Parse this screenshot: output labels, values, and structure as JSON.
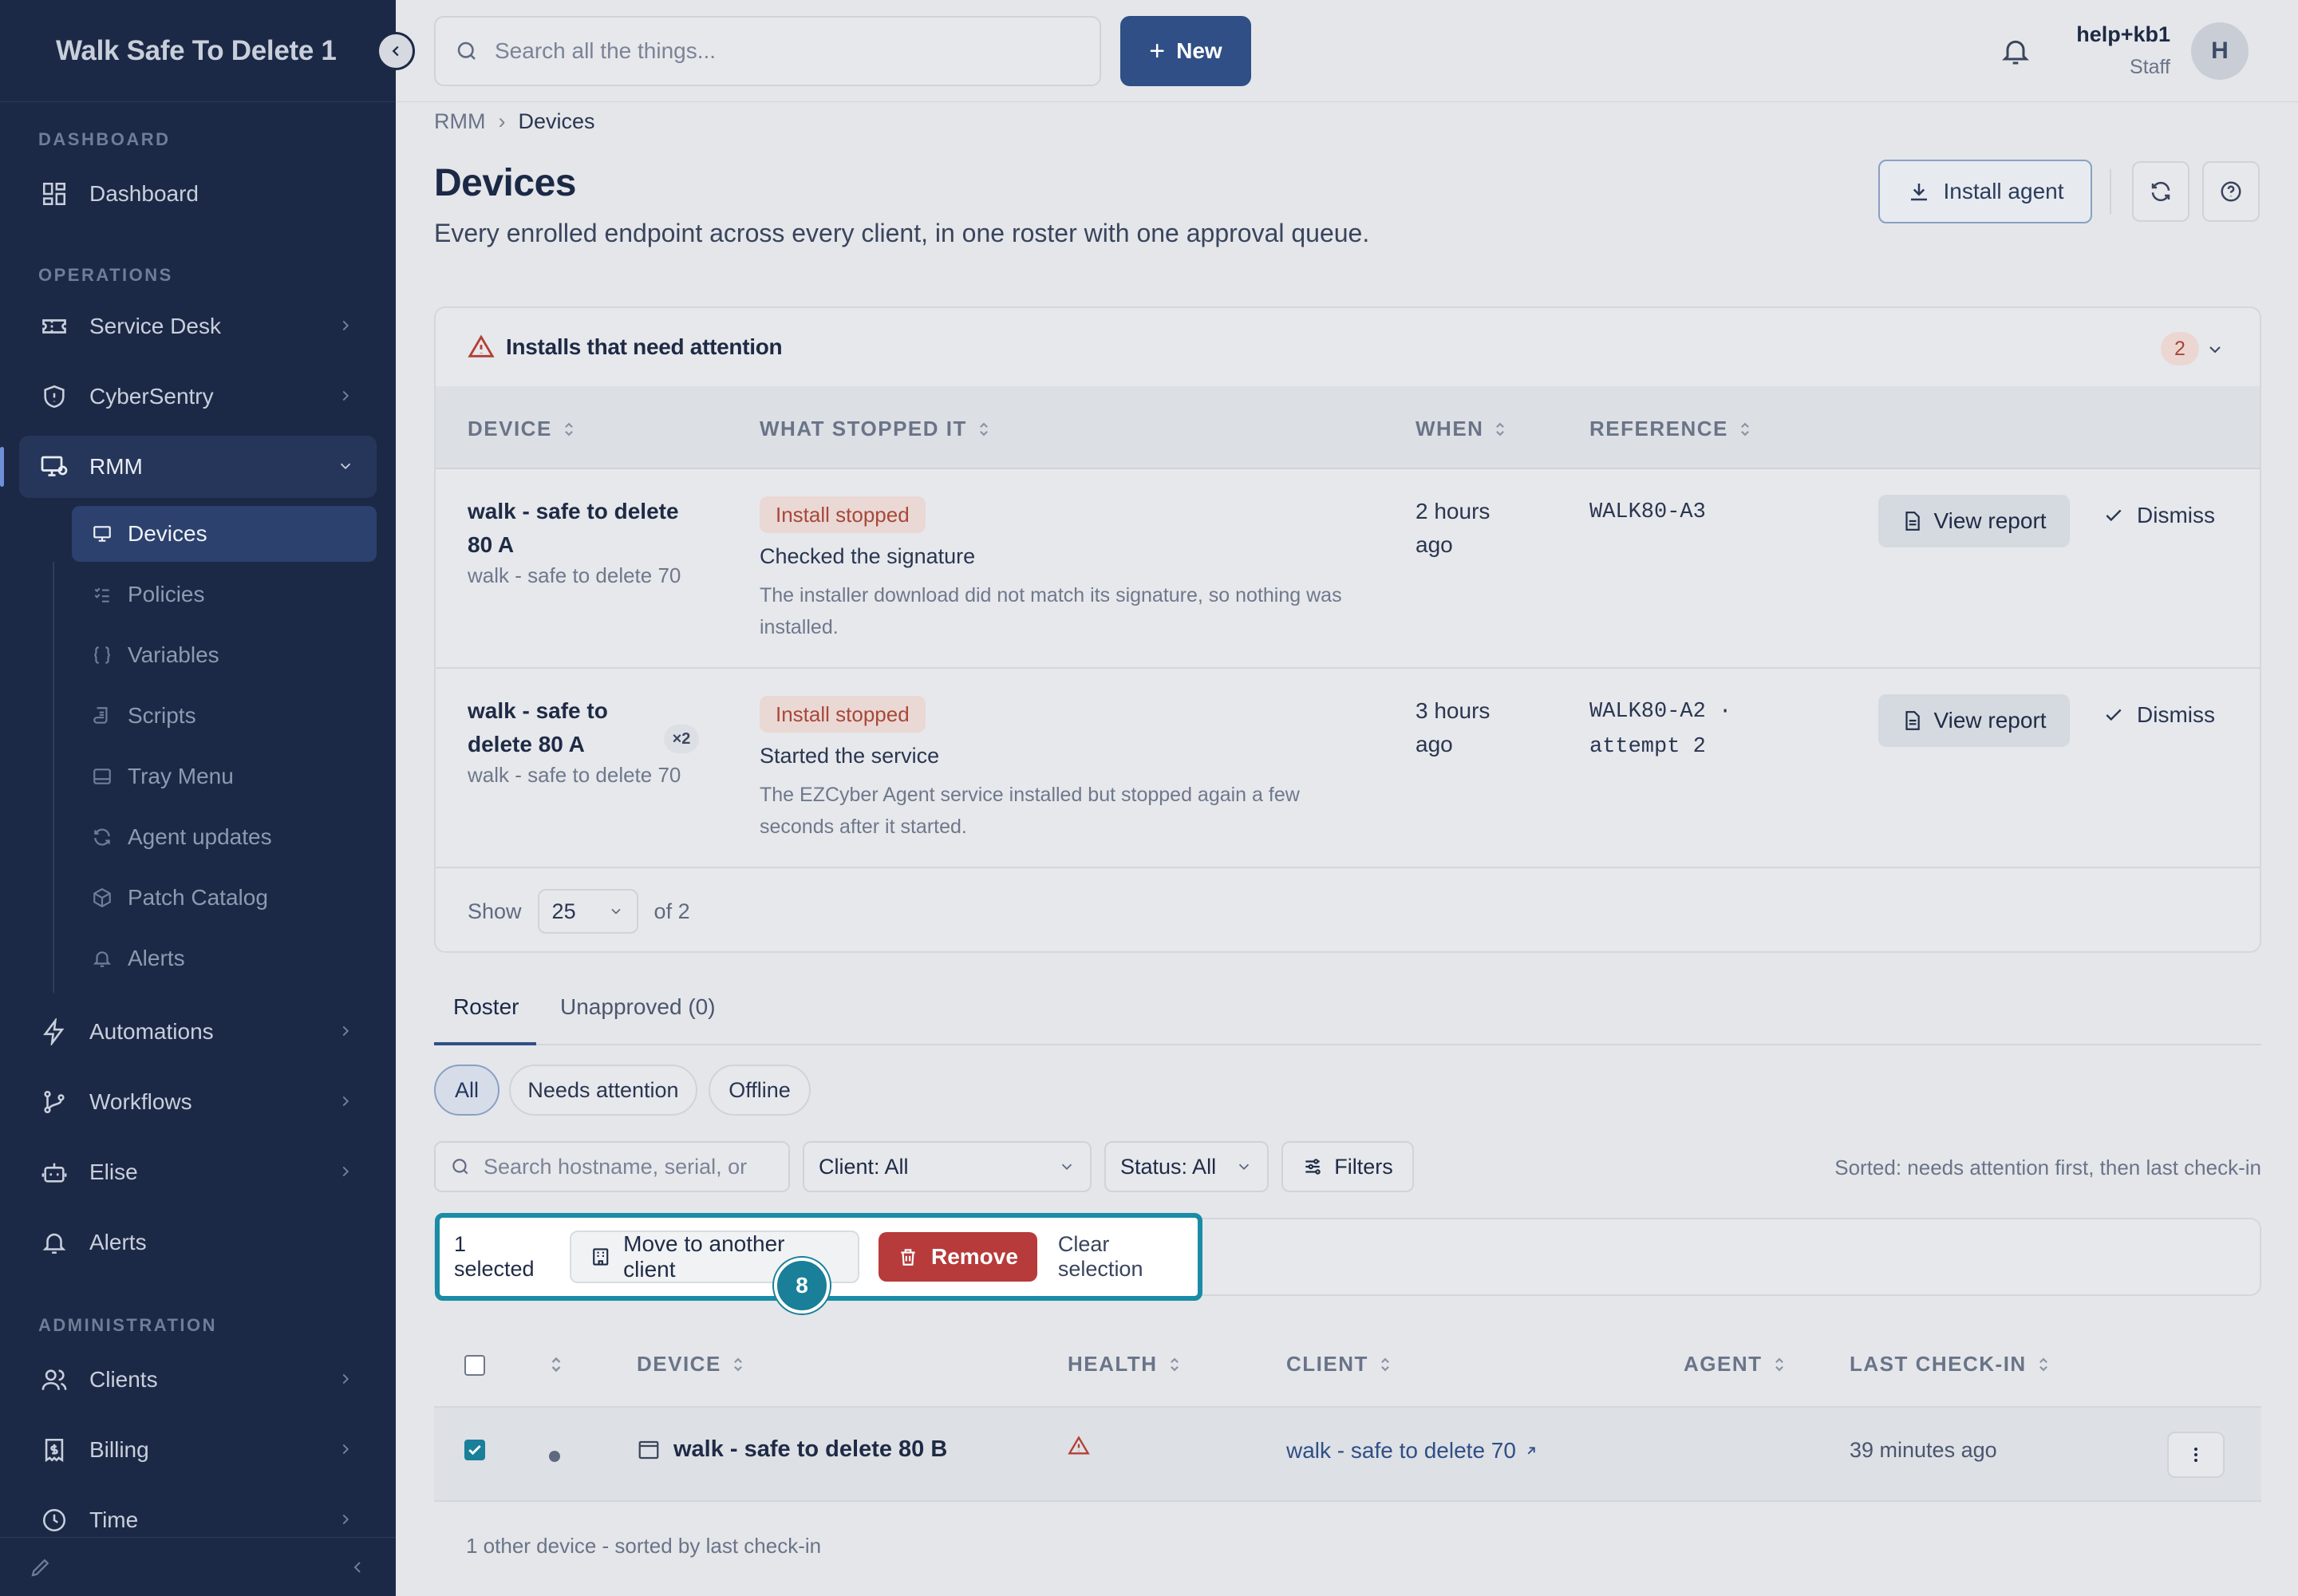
{
  "app": {
    "brand": "Walk Safe To Delete 1"
  },
  "sidebar": {
    "sections": {
      "dashboard": "DASHBOARD",
      "operations": "OPERATIONS",
      "administration": "ADMINISTRATION"
    },
    "items": {
      "dashboard": "Dashboard",
      "service_desk": "Service Desk",
      "cybersentry": "CyberSentry",
      "rmm": "RMM",
      "automations": "Automations",
      "workflows": "Workflows",
      "elise": "Elise",
      "alerts": "Alerts",
      "clients": "Clients",
      "billing": "Billing",
      "time": "Time"
    },
    "rmm_sub": {
      "devices": "Devices",
      "policies": "Policies",
      "variables": "Variables",
      "scripts": "Scripts",
      "tray_menu": "Tray Menu",
      "agent_updates": "Agent updates",
      "patch_catalog": "Patch Catalog",
      "alerts": "Alerts"
    }
  },
  "topbar": {
    "search_placeholder": "Search all the things...",
    "new_label": "New",
    "user_name": "help+kb1",
    "user_role": "Staff",
    "avatar_initial": "H"
  },
  "breadcrumb": {
    "parent": "RMM",
    "current": "Devices"
  },
  "page": {
    "title": "Devices",
    "subtitle": "Every enrolled endpoint across every client, in one roster with one approval queue.",
    "install_agent": "Install agent"
  },
  "attention": {
    "title": "Installs that need attention",
    "count": "2",
    "columns": {
      "device": "DEVICE",
      "what_stopped": "WHAT STOPPED IT",
      "when": "WHEN",
      "reference": "REFERENCE"
    },
    "rows": [
      {
        "device": "walk - safe to delete 80 A",
        "client": "walk - safe to delete 70",
        "multiplier": "",
        "status": "Install stopped",
        "step": "Checked the signature",
        "description": "The installer download did not match its signature, so nothing was installed.",
        "when": "2 hours ago",
        "reference": "WALK80-A3",
        "view_report": "View report",
        "dismiss": "Dismiss"
      },
      {
        "device": "walk - safe to delete 80 A",
        "client": "walk - safe to delete 70",
        "multiplier": "×2",
        "status": "Install stopped",
        "step": "Started the service",
        "description": "The EZCyber Agent service installed but stopped again a few seconds after it started.",
        "when": "3 hours ago",
        "reference": "WALK80-A2 · attempt 2",
        "view_report": "View report",
        "dismiss": "Dismiss"
      }
    ],
    "footer": {
      "show_label": "Show",
      "page_size": "25",
      "of_label": "of 2"
    }
  },
  "tabs": {
    "roster": "Roster",
    "unapproved": "Unapproved (0)"
  },
  "chips": {
    "all": "All",
    "needs_attention": "Needs attention",
    "offline": "Offline"
  },
  "filters": {
    "search_placeholder": "Search hostname, serial, or",
    "client": "Client: All",
    "status": "Status: All",
    "filters_label": "Filters",
    "sorted_note": "Sorted: needs attention first, then last check-in"
  },
  "bulk": {
    "step_number": "8",
    "selected": "1 selected",
    "move": "Move to another client",
    "remove": "Remove",
    "clear": "Clear selection"
  },
  "devices": {
    "columns": {
      "device": "DEVICE",
      "health": "HEALTH",
      "client": "CLIENT",
      "agent": "AGENT",
      "last_checkin": "LAST CHECK-IN"
    },
    "rows": [
      {
        "name": "walk - safe to delete 80 B",
        "client": "walk - safe to delete 70",
        "last_checkin": "39 minutes ago",
        "selected": true
      }
    ],
    "other_note": "1 other device - sorted by last check-in"
  },
  "colors": {
    "sidebar_bg": "#1b2946",
    "primary": "#2f4f86",
    "danger": "#b73b3b",
    "highlight": "#1a8ca5"
  }
}
